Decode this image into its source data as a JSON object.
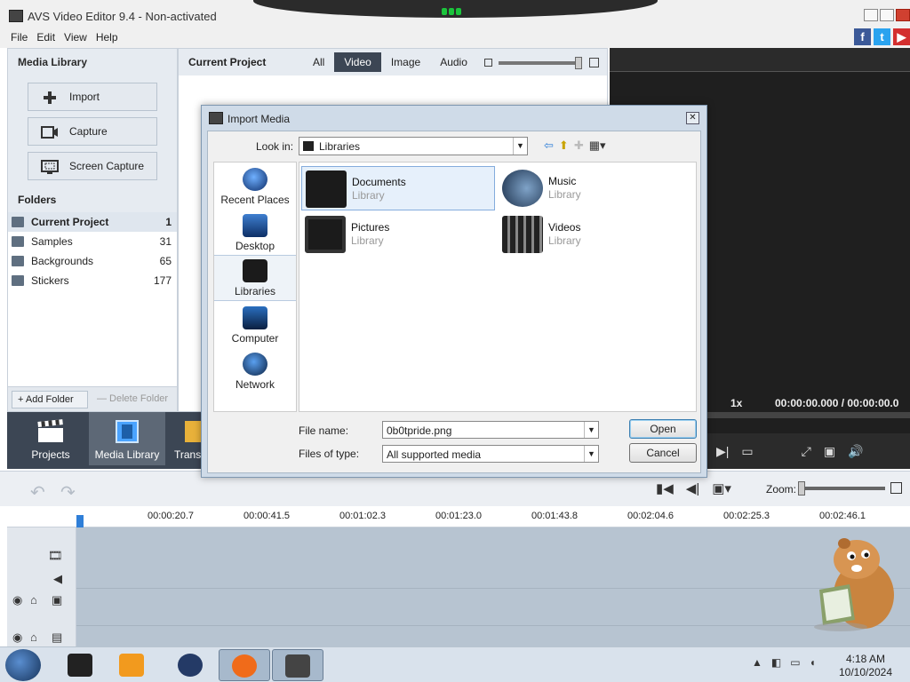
{
  "window": {
    "title": "AVS Video Editor 9.4 - Non-activated"
  },
  "menu": [
    "File",
    "Edit",
    "View",
    "Help"
  ],
  "social": {
    "facebook": "f",
    "twitter": "t",
    "youtube": "▶"
  },
  "media_library": {
    "title": "Media Library",
    "buttons": [
      "Import",
      "Capture",
      "Screen Capture"
    ],
    "folders_title": "Folders",
    "folders": [
      {
        "name": "Current Project",
        "count": "1"
      },
      {
        "name": "Samples",
        "count": "31"
      },
      {
        "name": "Backgrounds",
        "count": "65"
      },
      {
        "name": "Stickers",
        "count": "177"
      }
    ],
    "add_folder": "+ Add Folder",
    "delete_folder": "— Delete Folder"
  },
  "current_project": {
    "title": "Current Project",
    "tabs": [
      "All",
      "Video",
      "Image",
      "Audio"
    ],
    "active_tab": "Video"
  },
  "preview": {
    "speed": "1x",
    "time": "00:00:00.000  /  00:00:00.0"
  },
  "nav": {
    "items": [
      "Projects",
      "Media Library",
      "Transi"
    ]
  },
  "timeline": {
    "zoom_label": "Zoom:",
    "ruler": [
      "00:00:20.7",
      "00:00:41.5",
      "00:01:02.3",
      "00:01:23.0",
      "00:01:43.8",
      "00:02:04.6",
      "00:02:25.3",
      "00:02:46.1"
    ]
  },
  "taskbar": {
    "time": "4:18 AM",
    "date": "10/10/2024"
  },
  "dialog": {
    "title": "Import Media",
    "look_in_label": "Look in:",
    "look_in_value": "Libraries",
    "places": [
      "Recent Places",
      "Desktop",
      "Libraries",
      "Computer",
      "Network"
    ],
    "selected_place": "Libraries",
    "files": [
      {
        "name": "Documents",
        "sub": "Library"
      },
      {
        "name": "Music",
        "sub": "Library"
      },
      {
        "name": "Pictures",
        "sub": "Library"
      },
      {
        "name": "Videos",
        "sub": "Library"
      }
    ],
    "file_name_label": "File name:",
    "file_name_value": "0b0tpride.png",
    "file_type_label": "Files of type:",
    "file_type_value": "All supported media",
    "open_label": "Open",
    "cancel_label": "Cancel"
  },
  "colors": {
    "nav_bg": "#3c4654",
    "accent": "#2f7fd8",
    "preview_bg": "#2b2b2b"
  }
}
